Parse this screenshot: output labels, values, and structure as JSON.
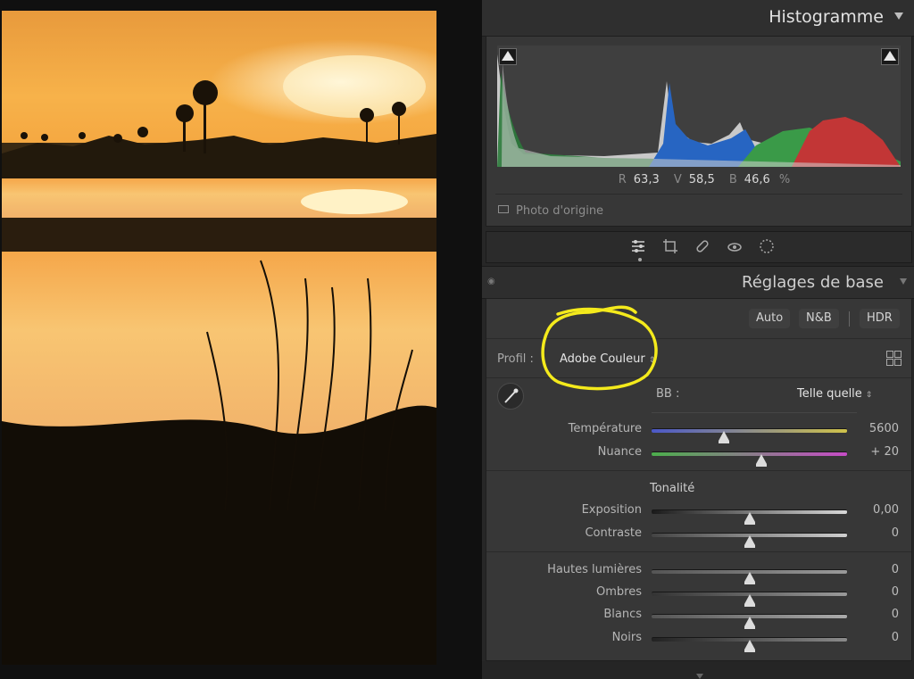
{
  "header": {
    "title": "Histogramme"
  },
  "histogram": {
    "readout": [
      {
        "label": "R",
        "value": "63,3"
      },
      {
        "label": "V",
        "value": "58,5"
      },
      {
        "label": "B",
        "value": "46,6"
      }
    ],
    "unit": "%",
    "original_photo_label": "Photo d'origine"
  },
  "tools": [
    "edit-icon",
    "crop-icon",
    "heal-icon",
    "redeye-icon",
    "mask-icon"
  ],
  "basic": {
    "title": "Réglages de base",
    "buttons": {
      "auto": "Auto",
      "bw": "N&B",
      "hdr": "HDR"
    },
    "profile_label": "Profil :",
    "profile_value": "Adobe Couleur",
    "wb_label": "BB :",
    "wb_value": "Telle quelle",
    "tonalite": "Tonalité",
    "sliders": [
      {
        "name": "Température",
        "value": "5600",
        "level": 0.37
      },
      {
        "name": "Nuance",
        "value": "+ 20",
        "level": 0.56
      },
      {
        "name": "Exposition",
        "value": "0,00",
        "level": 0.5
      },
      {
        "name": "Contraste",
        "value": "0",
        "level": 0.5
      },
      {
        "name": "Hautes lumières",
        "value": "0",
        "level": 0.5
      },
      {
        "name": "Ombres",
        "value": "0",
        "level": 0.5
      },
      {
        "name": "Blancs",
        "value": "0",
        "level": 0.5
      },
      {
        "name": "Noirs",
        "value": "0",
        "level": 0.5
      }
    ]
  },
  "colors": {
    "annotation": "#f4ea1c",
    "panel": "#373737"
  }
}
